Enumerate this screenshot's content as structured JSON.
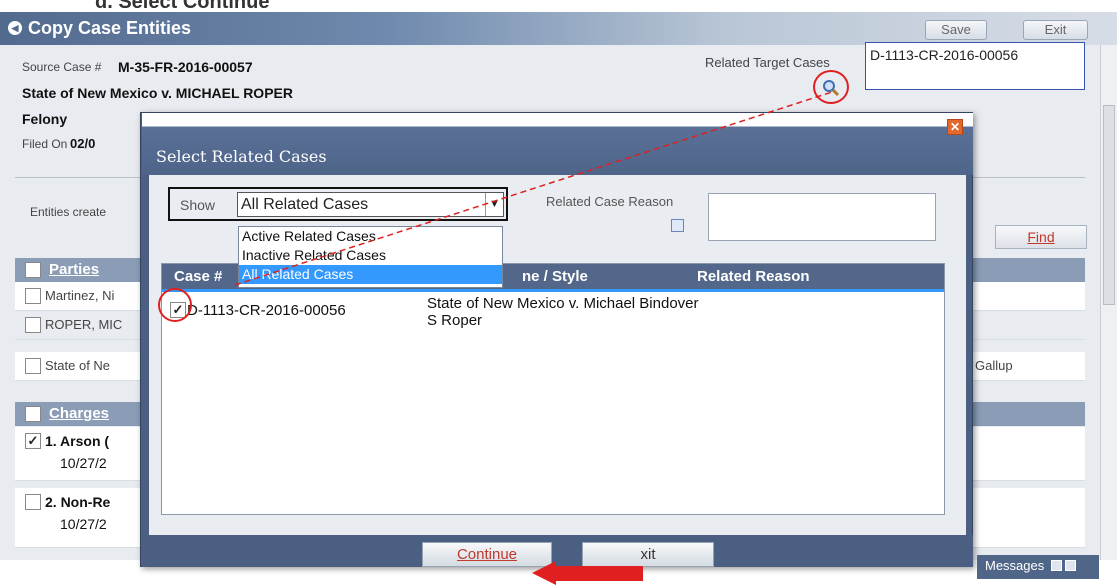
{
  "instruction": "d. Select Continue",
  "window": {
    "title": "Copy Case Entities",
    "save_label": "Save",
    "exit_label": "Exit"
  },
  "case": {
    "source_label": "Source Case #",
    "source_number": "M-35-FR-2016-00057",
    "style": "State of New Mexico v. MICHAEL ROPER",
    "type": "Felony",
    "filed_label": "Filed On",
    "filed_value": "02/0",
    "related_target_label": "Related Target Cases",
    "related_target_value": "D-1113-CR-2016-00056"
  },
  "entities_created_label": "Entities create",
  "find_label": "Find",
  "parties": {
    "header": "Parties",
    "rows": [
      "Martinez, Ni",
      "ROPER, MIC",
      "State of Ne"
    ],
    "extra": "Gallup"
  },
  "charges": {
    "header": "Charges",
    "rows": [
      {
        "label": "1. Arson (",
        "date": "10/27/2",
        "checked": true
      },
      {
        "label": "2. Non-Re",
        "date": "10/27/2",
        "checked": false
      }
    ]
  },
  "dialog": {
    "title": "Select Related Cases",
    "show_label": "Show",
    "show_value": "All Related Cases",
    "dropdown_options": [
      "Active Related Cases",
      "Inactive Related Cases",
      "All Related Cases"
    ],
    "reason_label": "Related Case Reason",
    "grid": {
      "col_case": "Case #",
      "col_name": "ne / Style",
      "col_reason": "Related Reason",
      "rows": [
        {
          "case": "D-1113-CR-2016-00056",
          "name_line1": "State of New Mexico v. Michael Bindover",
          "name_line2": "S Roper",
          "checked": true
        }
      ]
    },
    "continue_label": "Continue",
    "exit_label": "xit"
  },
  "footer": {
    "messages_label": "Messages"
  },
  "colors": {
    "accent": "#4a5f82",
    "annotation": "#e02020",
    "selection": "#3399ff"
  }
}
